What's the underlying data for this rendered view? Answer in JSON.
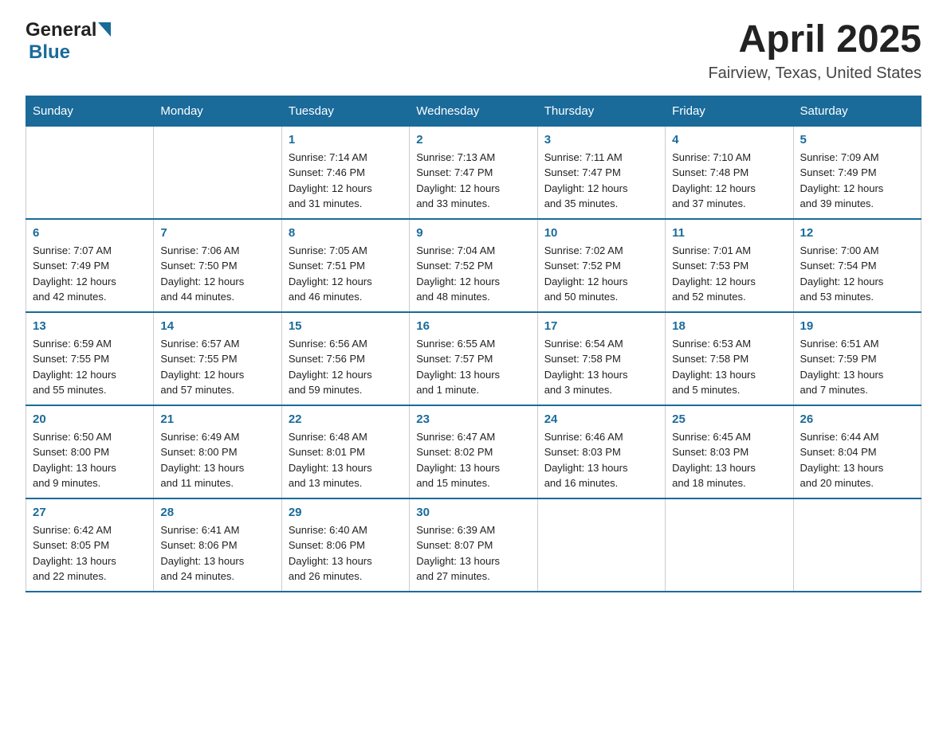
{
  "header": {
    "logo_general": "General",
    "logo_blue": "Blue",
    "month_title": "April 2025",
    "location": "Fairview, Texas, United States"
  },
  "days_of_week": [
    "Sunday",
    "Monday",
    "Tuesday",
    "Wednesday",
    "Thursday",
    "Friday",
    "Saturday"
  ],
  "weeks": [
    [
      {
        "day": "",
        "info": ""
      },
      {
        "day": "",
        "info": ""
      },
      {
        "day": "1",
        "info": "Sunrise: 7:14 AM\nSunset: 7:46 PM\nDaylight: 12 hours\nand 31 minutes."
      },
      {
        "day": "2",
        "info": "Sunrise: 7:13 AM\nSunset: 7:47 PM\nDaylight: 12 hours\nand 33 minutes."
      },
      {
        "day": "3",
        "info": "Sunrise: 7:11 AM\nSunset: 7:47 PM\nDaylight: 12 hours\nand 35 minutes."
      },
      {
        "day": "4",
        "info": "Sunrise: 7:10 AM\nSunset: 7:48 PM\nDaylight: 12 hours\nand 37 minutes."
      },
      {
        "day": "5",
        "info": "Sunrise: 7:09 AM\nSunset: 7:49 PM\nDaylight: 12 hours\nand 39 minutes."
      }
    ],
    [
      {
        "day": "6",
        "info": "Sunrise: 7:07 AM\nSunset: 7:49 PM\nDaylight: 12 hours\nand 42 minutes."
      },
      {
        "day": "7",
        "info": "Sunrise: 7:06 AM\nSunset: 7:50 PM\nDaylight: 12 hours\nand 44 minutes."
      },
      {
        "day": "8",
        "info": "Sunrise: 7:05 AM\nSunset: 7:51 PM\nDaylight: 12 hours\nand 46 minutes."
      },
      {
        "day": "9",
        "info": "Sunrise: 7:04 AM\nSunset: 7:52 PM\nDaylight: 12 hours\nand 48 minutes."
      },
      {
        "day": "10",
        "info": "Sunrise: 7:02 AM\nSunset: 7:52 PM\nDaylight: 12 hours\nand 50 minutes."
      },
      {
        "day": "11",
        "info": "Sunrise: 7:01 AM\nSunset: 7:53 PM\nDaylight: 12 hours\nand 52 minutes."
      },
      {
        "day": "12",
        "info": "Sunrise: 7:00 AM\nSunset: 7:54 PM\nDaylight: 12 hours\nand 53 minutes."
      }
    ],
    [
      {
        "day": "13",
        "info": "Sunrise: 6:59 AM\nSunset: 7:55 PM\nDaylight: 12 hours\nand 55 minutes."
      },
      {
        "day": "14",
        "info": "Sunrise: 6:57 AM\nSunset: 7:55 PM\nDaylight: 12 hours\nand 57 minutes."
      },
      {
        "day": "15",
        "info": "Sunrise: 6:56 AM\nSunset: 7:56 PM\nDaylight: 12 hours\nand 59 minutes."
      },
      {
        "day": "16",
        "info": "Sunrise: 6:55 AM\nSunset: 7:57 PM\nDaylight: 13 hours\nand 1 minute."
      },
      {
        "day": "17",
        "info": "Sunrise: 6:54 AM\nSunset: 7:58 PM\nDaylight: 13 hours\nand 3 minutes."
      },
      {
        "day": "18",
        "info": "Sunrise: 6:53 AM\nSunset: 7:58 PM\nDaylight: 13 hours\nand 5 minutes."
      },
      {
        "day": "19",
        "info": "Sunrise: 6:51 AM\nSunset: 7:59 PM\nDaylight: 13 hours\nand 7 minutes."
      }
    ],
    [
      {
        "day": "20",
        "info": "Sunrise: 6:50 AM\nSunset: 8:00 PM\nDaylight: 13 hours\nand 9 minutes."
      },
      {
        "day": "21",
        "info": "Sunrise: 6:49 AM\nSunset: 8:00 PM\nDaylight: 13 hours\nand 11 minutes."
      },
      {
        "day": "22",
        "info": "Sunrise: 6:48 AM\nSunset: 8:01 PM\nDaylight: 13 hours\nand 13 minutes."
      },
      {
        "day": "23",
        "info": "Sunrise: 6:47 AM\nSunset: 8:02 PM\nDaylight: 13 hours\nand 15 minutes."
      },
      {
        "day": "24",
        "info": "Sunrise: 6:46 AM\nSunset: 8:03 PM\nDaylight: 13 hours\nand 16 minutes."
      },
      {
        "day": "25",
        "info": "Sunrise: 6:45 AM\nSunset: 8:03 PM\nDaylight: 13 hours\nand 18 minutes."
      },
      {
        "day": "26",
        "info": "Sunrise: 6:44 AM\nSunset: 8:04 PM\nDaylight: 13 hours\nand 20 minutes."
      }
    ],
    [
      {
        "day": "27",
        "info": "Sunrise: 6:42 AM\nSunset: 8:05 PM\nDaylight: 13 hours\nand 22 minutes."
      },
      {
        "day": "28",
        "info": "Sunrise: 6:41 AM\nSunset: 8:06 PM\nDaylight: 13 hours\nand 24 minutes."
      },
      {
        "day": "29",
        "info": "Sunrise: 6:40 AM\nSunset: 8:06 PM\nDaylight: 13 hours\nand 26 minutes."
      },
      {
        "day": "30",
        "info": "Sunrise: 6:39 AM\nSunset: 8:07 PM\nDaylight: 13 hours\nand 27 minutes."
      },
      {
        "day": "",
        "info": ""
      },
      {
        "day": "",
        "info": ""
      },
      {
        "day": "",
        "info": ""
      }
    ]
  ]
}
